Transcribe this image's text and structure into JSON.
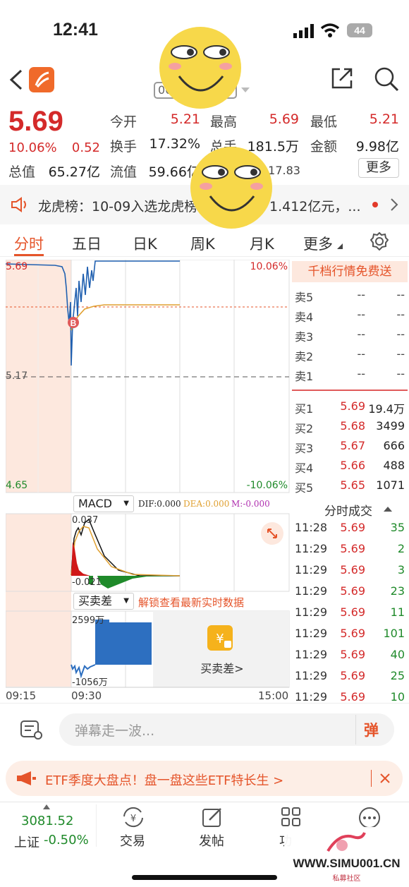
{
  "status_bar": {
    "time": "12:41",
    "battery": "44"
  },
  "header": {
    "stock_code": "00"
  },
  "quote": {
    "price": "5.69",
    "change_pct": "10.06%",
    "change": "0.52",
    "open_label": "今开",
    "open": "5.21",
    "high_label": "最高",
    "high": "5.69",
    "low_label": "最低",
    "low": "5.21",
    "turnover_label": "换手",
    "turnover": "17.32%",
    "volume_label": "总手",
    "volume": "181.5万",
    "amount_label": "金额",
    "amount": "9.98亿",
    "mktcap_label": "总值",
    "mktcap": "65.27亿",
    "float_label": "流值",
    "float_cap": "59.66亿",
    "partial_value": "217.83",
    "more_button": "更多"
  },
  "news": {
    "text": "龙虎榜：10-09入选龙虎榜",
    "text_tail": "1.412亿元，..."
  },
  "tabs": [
    "分时",
    "五日",
    "日K",
    "周K",
    "月K",
    "更多"
  ],
  "chart": {
    "price_top": "5.69",
    "price_mid": "5.17",
    "price_bottom": "4.65",
    "pct_top": "10.06%",
    "pct_bottom": "-10.06%",
    "marker": "B",
    "macd": {
      "label": "MACD",
      "dif": "DIF:0.000",
      "dea": "DEA:0.000",
      "m": "M:-0.000",
      "high": "0.037",
      "low": "-0.021"
    },
    "bsd": {
      "label": "买卖差",
      "unlock": "解锁查看最新实时数据",
      "high": "2599万",
      "low": "-1056万",
      "overlay": "买卖差>"
    },
    "time_start": "09:15",
    "time_open": "09:30",
    "time_end": "15:00"
  },
  "side_panel": {
    "promo": "千档行情免费送",
    "asks": [
      {
        "label": "卖5",
        "price": "--",
        "vol": "--"
      },
      {
        "label": "卖4",
        "price": "--",
        "vol": "--"
      },
      {
        "label": "卖3",
        "price": "--",
        "vol": "--"
      },
      {
        "label": "卖2",
        "price": "--",
        "vol": "--"
      },
      {
        "label": "卖1",
        "price": "--",
        "vol": "--"
      }
    ],
    "bids": [
      {
        "label": "买1",
        "price": "5.69",
        "vol": "19.4万"
      },
      {
        "label": "买2",
        "price": "5.68",
        "vol": "3499"
      },
      {
        "label": "买3",
        "price": "5.67",
        "vol": "666"
      },
      {
        "label": "买4",
        "price": "5.66",
        "vol": "488"
      },
      {
        "label": "买5",
        "price": "5.65",
        "vol": "1071"
      }
    ],
    "trades_title": "分时成交",
    "trades": [
      {
        "time": "11:28",
        "price": "5.69",
        "vol": "35"
      },
      {
        "time": "11:29",
        "price": "5.69",
        "vol": "2"
      },
      {
        "time": "11:29",
        "price": "5.69",
        "vol": "3"
      },
      {
        "time": "11:29",
        "price": "5.69",
        "vol": "23"
      },
      {
        "time": "11:29",
        "price": "5.69",
        "vol": "11"
      },
      {
        "time": "11:29",
        "price": "5.69",
        "vol": "101"
      },
      {
        "time": "11:29",
        "price": "5.69",
        "vol": "40"
      },
      {
        "time": "11:29",
        "price": "5.69",
        "vol": "25"
      },
      {
        "time": "11:29",
        "price": "5.69",
        "vol": "10"
      }
    ]
  },
  "comment": {
    "placeholder": "弹幕走一波...",
    "danmu_btn": "弹"
  },
  "ad": {
    "text": "ETF季度大盘点！盘一盘这些ETF特长生 >"
  },
  "bottom_nav": {
    "index_value": "3081.52",
    "index_name": "上证",
    "index_change": "-0.50%",
    "items": [
      "交易",
      "发帖",
      "功"
    ]
  },
  "watermark": {
    "site": "WWW.SIMU001.CN",
    "sub": "私募社区"
  },
  "colors": {
    "up": "#d42a2a",
    "down": "#1f8a2a",
    "accent": "#e5542a"
  }
}
